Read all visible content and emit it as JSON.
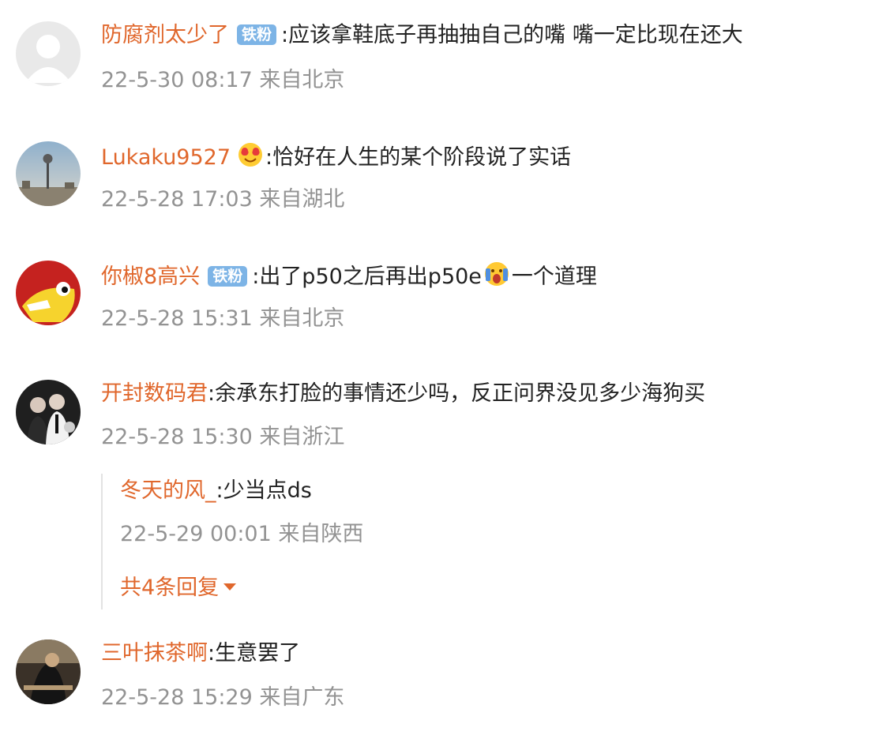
{
  "comments": [
    {
      "username": "防腐剂太少了",
      "badge": "铁粉",
      "colon": ":",
      "text": "应该拿鞋底子再抽抽自己的嘴  嘴一定比现在还大",
      "time": "22-5-30 08:17",
      "location": "来自北京",
      "avatar": "default-avatar"
    },
    {
      "username": "Lukaku9527",
      "emoji": "heart-eyes-emoji",
      "colon": ":",
      "text": "恰好在人生的某个阶段说了实话",
      "time": "22-5-28 17:03",
      "location": "来自湖北",
      "avatar": "tower-photo-avatar"
    },
    {
      "username": "你椒8高兴",
      "badge": "铁粉",
      "colon": ":",
      "text_before": "出了p50之后再出p50e",
      "emoji": "screaming-face-emoji",
      "text_after": "一个道理",
      "time": "22-5-28 15:31",
      "location": "来自北京",
      "avatar": "yellow-bird-avatar"
    },
    {
      "username": "开封数码君",
      "colon": ":",
      "text": "余承东打脸的事情还少吗，反正问界没见多少海狗买",
      "time": "22-5-28 15:30",
      "location": "来自浙江",
      "avatar": "couple-photo-avatar",
      "reply": {
        "username": "冬天的风_",
        "colon": ":",
        "text": "少当点ds",
        "time": "22-5-29 00:01",
        "location": "来自陕西"
      },
      "more_replies": "共4条回复"
    },
    {
      "username": "三叶抹茶啊",
      "colon": ":",
      "text": "生意罢了",
      "time": "22-5-28 15:29",
      "location": "来自广东",
      "avatar": "dark-photo-avatar"
    }
  ],
  "colors": {
    "username": "#e0672c",
    "body_text": "#222222",
    "meta_text": "#939393",
    "badge_bg": "#7db4e6"
  }
}
